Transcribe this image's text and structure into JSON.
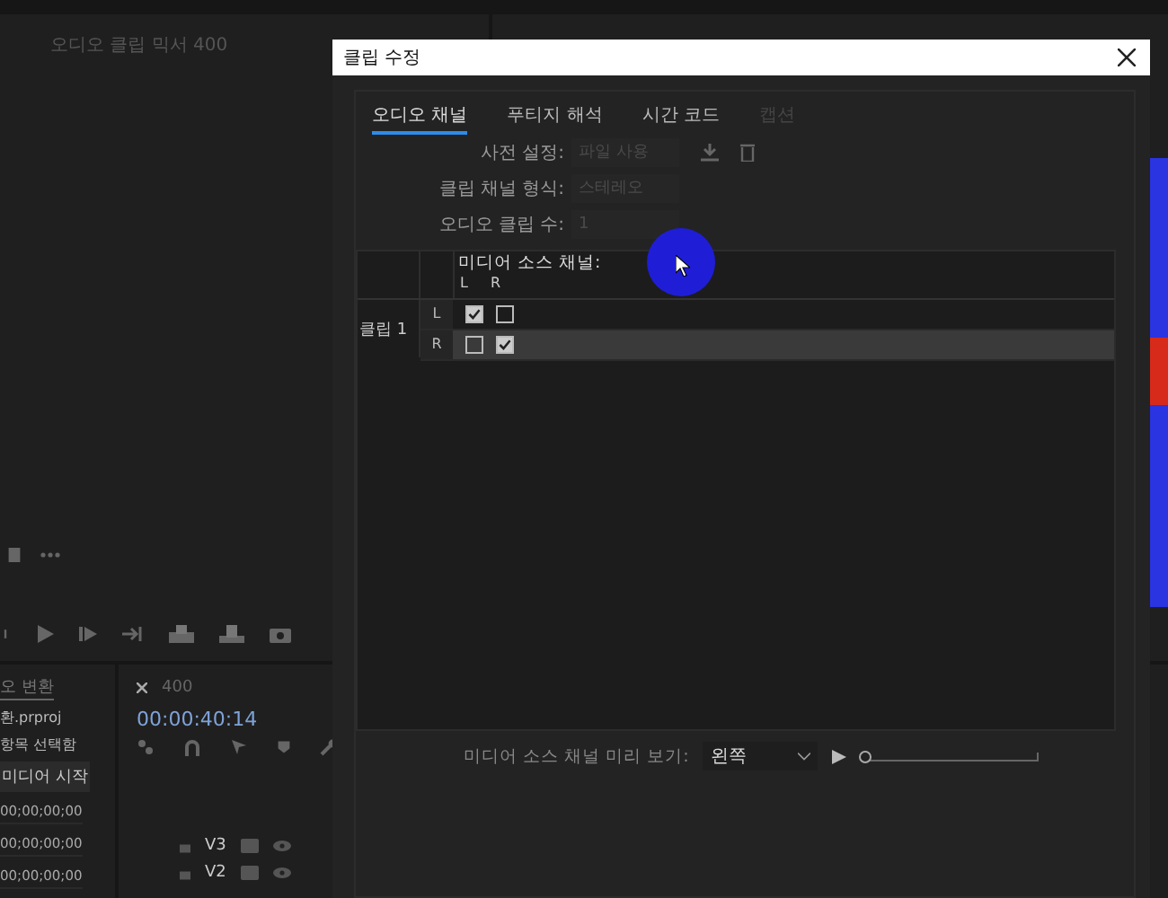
{
  "source_monitor": {
    "title": "오디오 클립 믹서 400"
  },
  "project_panel": {
    "tab": "오 변환",
    "file": "환.prproj",
    "selection": "항목 선택함",
    "column": "미디어 시작",
    "rows": [
      "00;00;00;00",
      "00;00;00;00",
      "00;00;00;00"
    ]
  },
  "timeline": {
    "sequence": "400",
    "timecode": "00:00:40:14",
    "tracks": [
      "V3",
      "V2"
    ]
  },
  "dialog": {
    "title": "클립 수정",
    "tabs": [
      {
        "label": "오디오 채널",
        "selected": true,
        "disabled": false
      },
      {
        "label": "푸티지 해석",
        "selected": false,
        "disabled": false
      },
      {
        "label": "시간 코드",
        "selected": false,
        "disabled": false
      },
      {
        "label": "캡션",
        "selected": false,
        "disabled": true
      }
    ],
    "fields": [
      {
        "label": "사전 설정:",
        "value": "파일 사용",
        "disabled": true,
        "kind": "preset"
      },
      {
        "label": "클립 채널 형식:",
        "value": "스테레오",
        "disabled": true,
        "kind": "select"
      },
      {
        "label": "오디오 클립 수:",
        "value": "1",
        "disabled": true,
        "kind": "number"
      }
    ],
    "channel_table": {
      "header": "미디어 소스 채널:",
      "columns": [
        "L",
        "R"
      ],
      "clip_label": "클립 1",
      "rows": [
        {
          "label": "L",
          "checks": [
            true,
            false
          ],
          "selected": false
        },
        {
          "label": "R",
          "checks": [
            false,
            true
          ],
          "selected": true
        }
      ]
    },
    "preview": {
      "label": "미디어 소스 채널 미리 보기:",
      "value": "왼쪽",
      "level": 0
    }
  }
}
